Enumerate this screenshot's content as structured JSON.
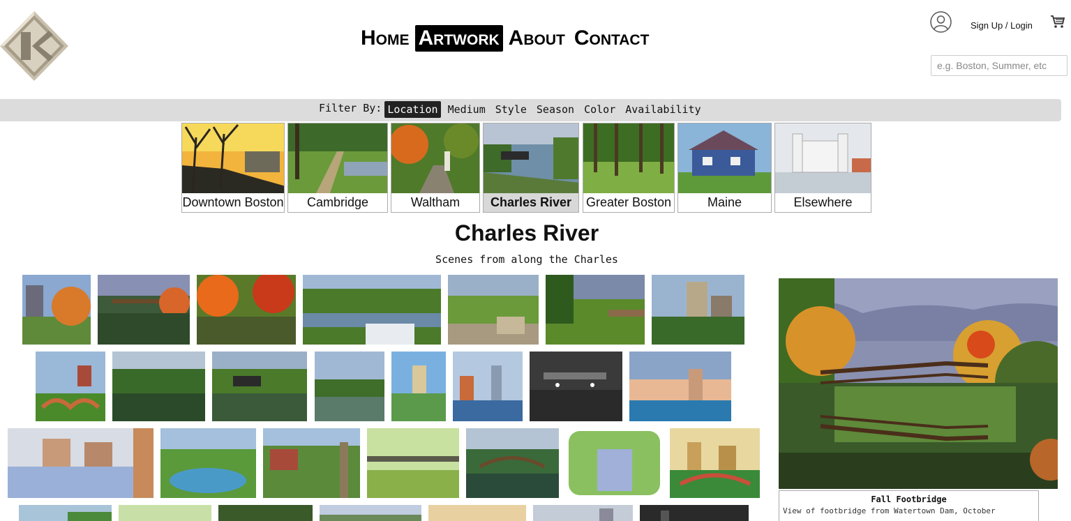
{
  "header": {
    "logo_name": "site-logo",
    "nav": [
      {
        "label": "Home",
        "active": false
      },
      {
        "label": "Artwork",
        "active": true
      },
      {
        "label": "About",
        "active": false
      },
      {
        "label": "Contact",
        "active": false
      }
    ],
    "signup_label": "Sign Up / Login",
    "search_placeholder": "e.g. Boston, Summer, etc"
  },
  "filter": {
    "label": "Filter By:",
    "options": [
      "Location",
      "Medium",
      "Style",
      "Season",
      "Color",
      "Availability"
    ],
    "active": "Location"
  },
  "locations": [
    {
      "label": "Downtown Boston"
    },
    {
      "label": "Cambridge"
    },
    {
      "label": "Waltham"
    },
    {
      "label": "Charles River",
      "active": true
    },
    {
      "label": "Greater Boston"
    },
    {
      "label": "Maine"
    },
    {
      "label": "Elsewhere"
    }
  ],
  "section": {
    "title": "Charles River",
    "subtitle": "Scenes from along the Charles"
  },
  "featured": {
    "title": "Fall Footbridge",
    "description": "View of footbridge from Watertown Dam, October"
  },
  "colors": {
    "active_bg": "#000000",
    "filter_bar": "#dcdcdc",
    "active_tile": "#d8d8d8"
  }
}
